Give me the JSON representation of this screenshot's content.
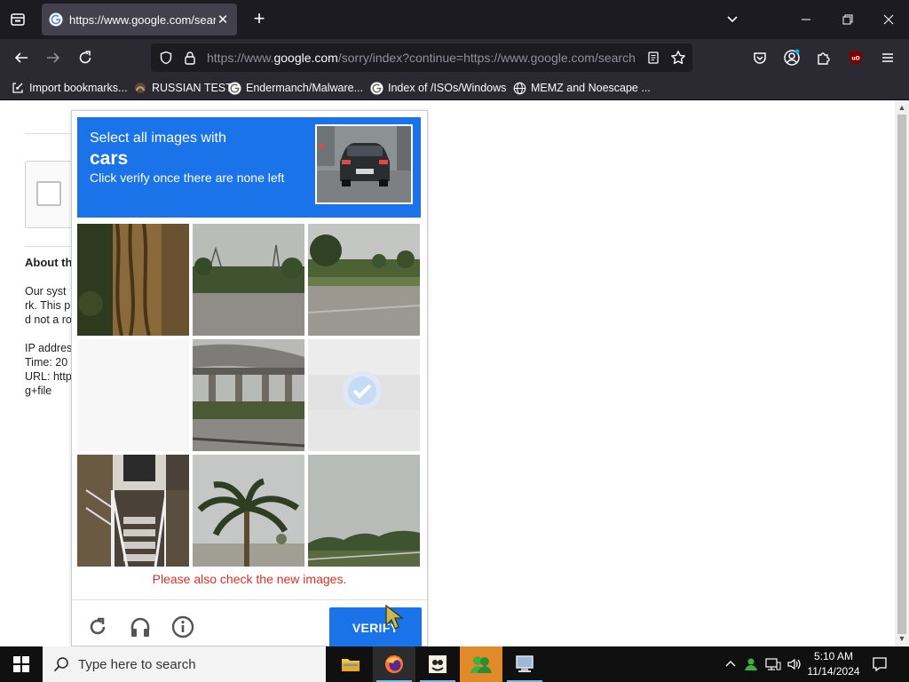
{
  "browser": {
    "tab": {
      "title": "https://www.google.com/search",
      "close_label": "✕"
    },
    "new_tab_label": "+",
    "url": {
      "prefix": "https://www.",
      "domain": "google.com",
      "rest": "/sorry/index?continue=https://www.google.com/search"
    },
    "bookmarks": [
      {
        "label": "Import bookmarks...",
        "icon": "import-icon"
      },
      {
        "label": "RUSSIAN TEST",
        "icon": "site-icon"
      },
      {
        "label": "Endermanch/Malware...",
        "icon": "google-icon"
      },
      {
        "label": "Index of /ISOs/Windows",
        "icon": "google-icon"
      },
      {
        "label": "MEMZ and Noescape ...",
        "icon": "globe-icon"
      }
    ],
    "ublock_badge": "uO"
  },
  "background_page": {
    "about_heading": "About th",
    "lines": [
      "Our syst",
      "rk. This p",
      "d not a ro",
      "",
      "IP addres",
      "Time: 20",
      "URL: http",
      "g+file"
    ]
  },
  "captcha": {
    "header_line1": "Select all images with",
    "header_target": "cars",
    "header_line3": "Click verify once there are none left",
    "tiles": [
      {
        "id": "tree-trunk",
        "selected": false
      },
      {
        "id": "road-trees",
        "selected": false
      },
      {
        "id": "road-field",
        "selected": false
      },
      {
        "id": "blank-loading",
        "selected": false
      },
      {
        "id": "bridge",
        "selected": false
      },
      {
        "id": "faded-selected",
        "selected": true
      },
      {
        "id": "stairs-house",
        "selected": false
      },
      {
        "id": "palm-tree",
        "selected": false
      },
      {
        "id": "field-trees",
        "selected": false
      }
    ],
    "error_message": "Please also check the new images.",
    "verify_label": "VERIFY",
    "colors": {
      "header": "#1a73e8",
      "error": "#d93025"
    }
  },
  "taskbar": {
    "search_placeholder": "Type here to search",
    "time": "5:10 AM",
    "date": "11/14/2024"
  }
}
